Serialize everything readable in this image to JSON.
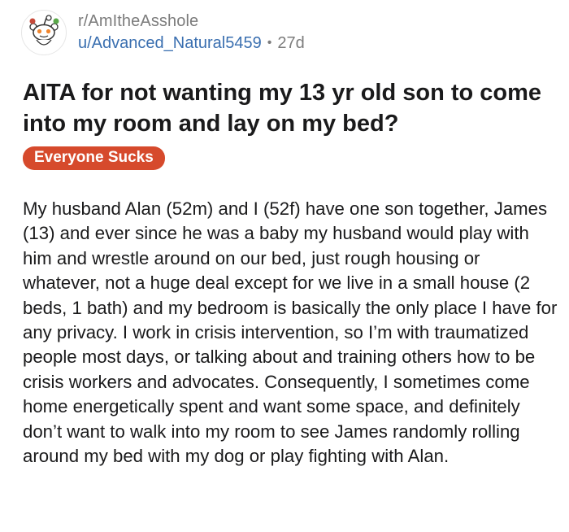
{
  "post": {
    "subreddit": "r/AmItheAsshole",
    "username": "u/Advanced_Natural5459",
    "separator": "•",
    "age": "27d",
    "avatar_icon": "snoo-icon",
    "title": "AITA for not wanting my 13 yr old son to come into my room and lay on my bed?",
    "flair": {
      "label": "Everyone Sucks",
      "color": "#d64a2c"
    },
    "body": "My husband Alan (52m) and I (52f) have one son together, James (13) and ever since he was a baby my husband would play with him and wrestle around on our bed, just rough housing or whatever, not a huge deal except for we live in a small house (2 beds, 1 bath) and my bedroom is basically the only place I have for any privacy. I work in crisis intervention, so I’m with traumatized people most days, or talking about and training others how to be crisis workers and advocates. Consequently, I sometimes come home energetically spent and want some space, and definitely don’t want to walk into my room to see James randomly rolling around my bed with my dog or play fighting with Alan."
  },
  "colors": {
    "link_blue": "#3a6fb0",
    "muted_gray": "#7c7c7c",
    "text": "#1a1a1b"
  }
}
